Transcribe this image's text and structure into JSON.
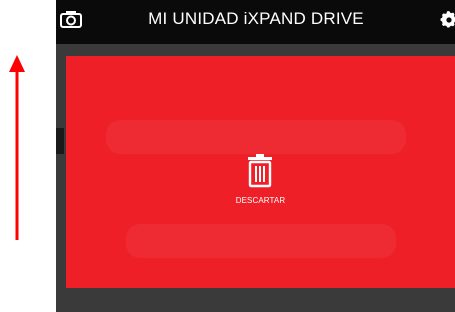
{
  "header": {
    "title": "MI UNIDAD iXPAND DRIVE",
    "left_icon": "camera-icon",
    "right_icon": "gear-icon"
  },
  "overlay": {
    "label": "DESCARTAR",
    "icon": "trash-icon",
    "color": "#ee1f27"
  },
  "annotation": {
    "icon": "up-arrow",
    "color": "#ff0000"
  },
  "colors": {
    "topbar": "#0a0a0a",
    "background": "#3a3a3a",
    "text": "#ffffff"
  }
}
